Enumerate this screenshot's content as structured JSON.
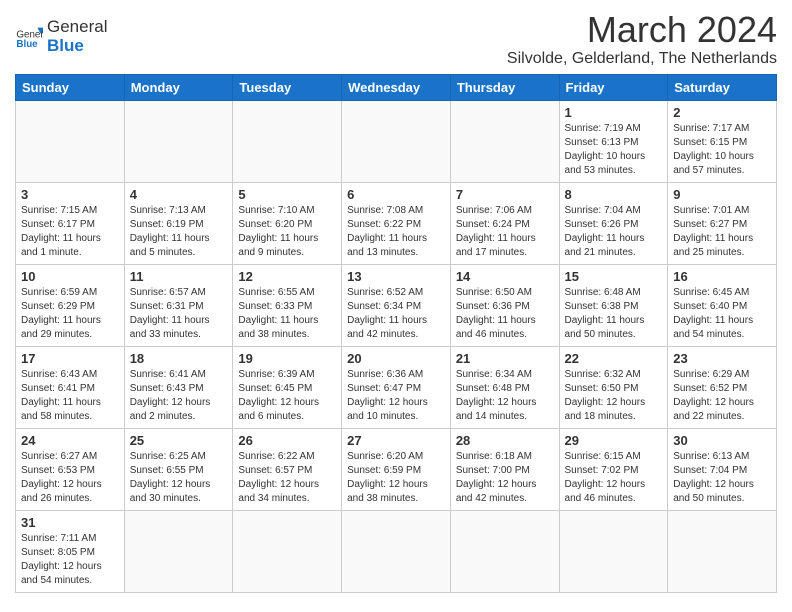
{
  "header": {
    "logo_general": "General",
    "logo_blue": "Blue",
    "month_title": "March 2024",
    "subtitle": "Silvolde, Gelderland, The Netherlands"
  },
  "weekdays": [
    "Sunday",
    "Monday",
    "Tuesday",
    "Wednesday",
    "Thursday",
    "Friday",
    "Saturday"
  ],
  "weeks": [
    [
      {
        "day": "",
        "info": ""
      },
      {
        "day": "",
        "info": ""
      },
      {
        "day": "",
        "info": ""
      },
      {
        "day": "",
        "info": ""
      },
      {
        "day": "",
        "info": ""
      },
      {
        "day": "1",
        "info": "Sunrise: 7:19 AM\nSunset: 6:13 PM\nDaylight: 10 hours\nand 53 minutes."
      },
      {
        "day": "2",
        "info": "Sunrise: 7:17 AM\nSunset: 6:15 PM\nDaylight: 10 hours\nand 57 minutes."
      }
    ],
    [
      {
        "day": "3",
        "info": "Sunrise: 7:15 AM\nSunset: 6:17 PM\nDaylight: 11 hours\nand 1 minute."
      },
      {
        "day": "4",
        "info": "Sunrise: 7:13 AM\nSunset: 6:19 PM\nDaylight: 11 hours\nand 5 minutes."
      },
      {
        "day": "5",
        "info": "Sunrise: 7:10 AM\nSunset: 6:20 PM\nDaylight: 11 hours\nand 9 minutes."
      },
      {
        "day": "6",
        "info": "Sunrise: 7:08 AM\nSunset: 6:22 PM\nDaylight: 11 hours\nand 13 minutes."
      },
      {
        "day": "7",
        "info": "Sunrise: 7:06 AM\nSunset: 6:24 PM\nDaylight: 11 hours\nand 17 minutes."
      },
      {
        "day": "8",
        "info": "Sunrise: 7:04 AM\nSunset: 6:26 PM\nDaylight: 11 hours\nand 21 minutes."
      },
      {
        "day": "9",
        "info": "Sunrise: 7:01 AM\nSunset: 6:27 PM\nDaylight: 11 hours\nand 25 minutes."
      }
    ],
    [
      {
        "day": "10",
        "info": "Sunrise: 6:59 AM\nSunset: 6:29 PM\nDaylight: 11 hours\nand 29 minutes."
      },
      {
        "day": "11",
        "info": "Sunrise: 6:57 AM\nSunset: 6:31 PM\nDaylight: 11 hours\nand 33 minutes."
      },
      {
        "day": "12",
        "info": "Sunrise: 6:55 AM\nSunset: 6:33 PM\nDaylight: 11 hours\nand 38 minutes."
      },
      {
        "day": "13",
        "info": "Sunrise: 6:52 AM\nSunset: 6:34 PM\nDaylight: 11 hours\nand 42 minutes."
      },
      {
        "day": "14",
        "info": "Sunrise: 6:50 AM\nSunset: 6:36 PM\nDaylight: 11 hours\nand 46 minutes."
      },
      {
        "day": "15",
        "info": "Sunrise: 6:48 AM\nSunset: 6:38 PM\nDaylight: 11 hours\nand 50 minutes."
      },
      {
        "day": "16",
        "info": "Sunrise: 6:45 AM\nSunset: 6:40 PM\nDaylight: 11 hours\nand 54 minutes."
      }
    ],
    [
      {
        "day": "17",
        "info": "Sunrise: 6:43 AM\nSunset: 6:41 PM\nDaylight: 11 hours\nand 58 minutes."
      },
      {
        "day": "18",
        "info": "Sunrise: 6:41 AM\nSunset: 6:43 PM\nDaylight: 12 hours\nand 2 minutes."
      },
      {
        "day": "19",
        "info": "Sunrise: 6:39 AM\nSunset: 6:45 PM\nDaylight: 12 hours\nand 6 minutes."
      },
      {
        "day": "20",
        "info": "Sunrise: 6:36 AM\nSunset: 6:47 PM\nDaylight: 12 hours\nand 10 minutes."
      },
      {
        "day": "21",
        "info": "Sunrise: 6:34 AM\nSunset: 6:48 PM\nDaylight: 12 hours\nand 14 minutes."
      },
      {
        "day": "22",
        "info": "Sunrise: 6:32 AM\nSunset: 6:50 PM\nDaylight: 12 hours\nand 18 minutes."
      },
      {
        "day": "23",
        "info": "Sunrise: 6:29 AM\nSunset: 6:52 PM\nDaylight: 12 hours\nand 22 minutes."
      }
    ],
    [
      {
        "day": "24",
        "info": "Sunrise: 6:27 AM\nSunset: 6:53 PM\nDaylight: 12 hours\nand 26 minutes."
      },
      {
        "day": "25",
        "info": "Sunrise: 6:25 AM\nSunset: 6:55 PM\nDaylight: 12 hours\nand 30 minutes."
      },
      {
        "day": "26",
        "info": "Sunrise: 6:22 AM\nSunset: 6:57 PM\nDaylight: 12 hours\nand 34 minutes."
      },
      {
        "day": "27",
        "info": "Sunrise: 6:20 AM\nSunset: 6:59 PM\nDaylight: 12 hours\nand 38 minutes."
      },
      {
        "day": "28",
        "info": "Sunrise: 6:18 AM\nSunset: 7:00 PM\nDaylight: 12 hours\nand 42 minutes."
      },
      {
        "day": "29",
        "info": "Sunrise: 6:15 AM\nSunset: 7:02 PM\nDaylight: 12 hours\nand 46 minutes."
      },
      {
        "day": "30",
        "info": "Sunrise: 6:13 AM\nSunset: 7:04 PM\nDaylight: 12 hours\nand 50 minutes."
      }
    ],
    [
      {
        "day": "31",
        "info": "Sunrise: 7:11 AM\nSunset: 8:05 PM\nDaylight: 12 hours\nand 54 minutes."
      },
      {
        "day": "",
        "info": ""
      },
      {
        "day": "",
        "info": ""
      },
      {
        "day": "",
        "info": ""
      },
      {
        "day": "",
        "info": ""
      },
      {
        "day": "",
        "info": ""
      },
      {
        "day": "",
        "info": ""
      }
    ]
  ]
}
